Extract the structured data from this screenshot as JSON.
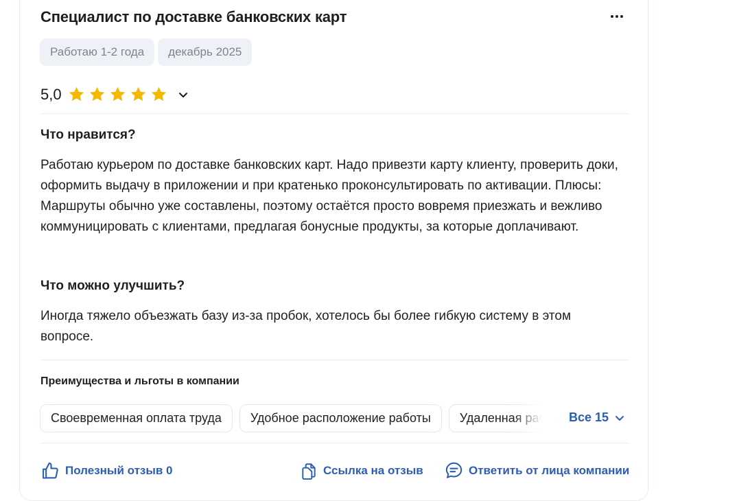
{
  "review": {
    "title": "Специалист по доставке банковских карт",
    "more_icon": "more-horizontal-icon",
    "tags": [
      "Работаю 1-2 года",
      "декабрь 2025"
    ],
    "rating": {
      "value": "5,0",
      "stars": 5,
      "max": 5,
      "star_color": "#f5b800"
    },
    "likes_title": "Что нравится?",
    "likes_text": "Работаю курьером по доставке банковских карт. Надо привезти карту клиенту, проверить доки, оформить выдачу в приложении и при кратенько проконсультировать по активации. Плюсы: Маршруты обычно уже составлены, поэтому остаётся просто вовремя приезжать и вежливо коммуницировать с клиентами, предлагая бонусные продукты, за которые доплачивают.",
    "improve_title": "Что можно улучшить?",
    "improve_text": "Иногда тяжело объезжать базу из-за пробок, хотелось бы более гибкую систему в этом вопросе.",
    "perks_title": "Преимущества и льготы в компании",
    "perks": [
      "Своевременная оплата труда",
      "Удобное расположение работы",
      "Удаленная работа"
    ],
    "perks_all_label": "Все 15",
    "actions": {
      "helpful_label": "Полезный отзыв 0",
      "link_label": "Ссылка на отзыв",
      "reply_label": "Ответить от лица компании"
    },
    "accent_color": "#2d5db3"
  }
}
